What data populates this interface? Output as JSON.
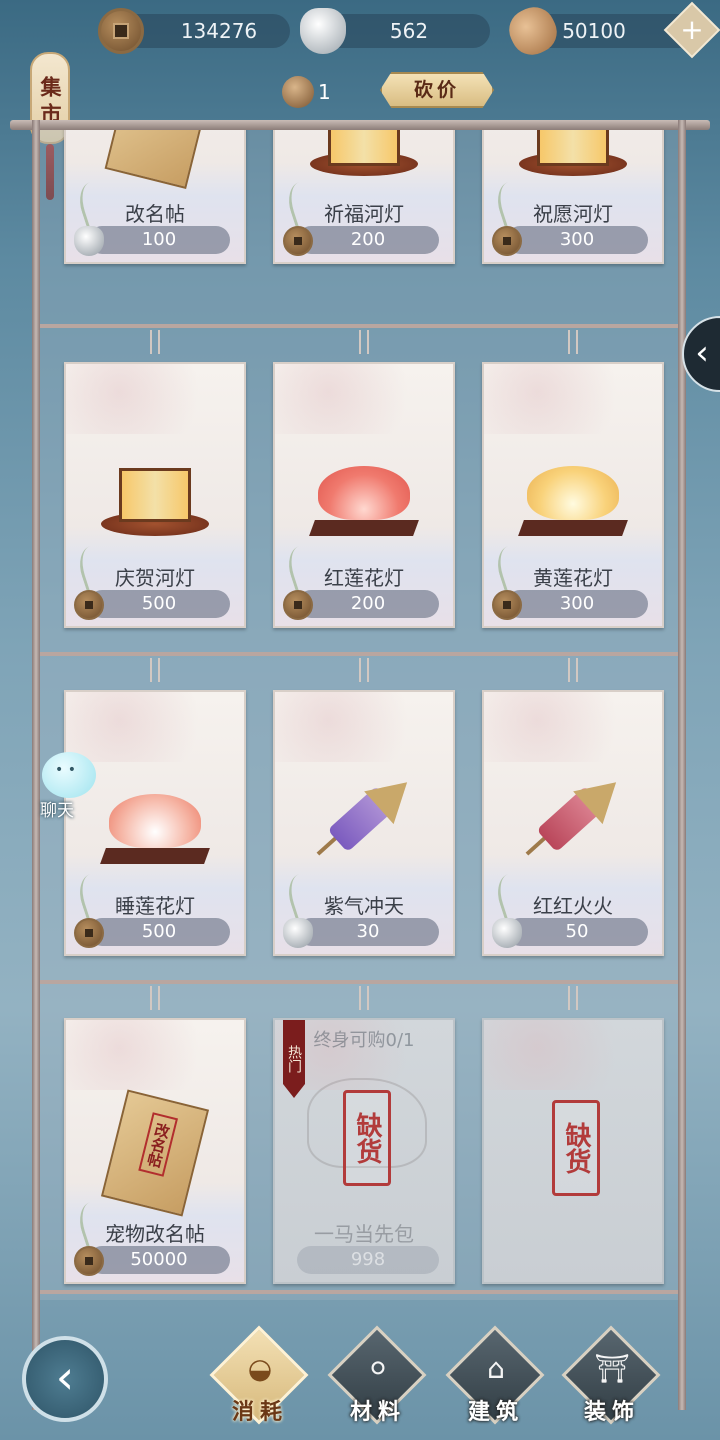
{
  "currency": {
    "coins": "134276",
    "silver": "562",
    "shells": "50100",
    "add_label": "+"
  },
  "market_sign": "集市",
  "bargain": {
    "token_count": "1",
    "button_label": "砍价"
  },
  "rows": [
    [
      {
        "name": "改名帖",
        "price": "100",
        "currency_icon": "silver-icon"
      },
      {
        "name": "祈福河灯",
        "price": "200",
        "currency_icon": "coin-icon"
      },
      {
        "name": "祝愿河灯",
        "price": "300",
        "currency_icon": "coin-icon"
      }
    ],
    [
      {
        "name": "庆贺河灯",
        "price": "500",
        "currency_icon": "coin-icon"
      },
      {
        "name": "红莲花灯",
        "price": "200",
        "currency_icon": "coin-icon"
      },
      {
        "name": "黄莲花灯",
        "price": "300",
        "currency_icon": "coin-icon"
      }
    ],
    [
      {
        "name": "睡莲花灯",
        "price": "500",
        "currency_icon": "coin-icon"
      },
      {
        "name": "紫气冲天",
        "price": "30",
        "currency_icon": "silver-icon"
      },
      {
        "name": "红红火火",
        "price": "50",
        "currency_icon": "silver-icon"
      }
    ],
    [
      {
        "name": "宠物改名帖",
        "price": "50000",
        "currency_icon": "coin-icon",
        "art_text": "改名帖"
      },
      {
        "name": "一马当先包",
        "price": "998",
        "currency_icon": "silver-icon",
        "sold_out": "缺货",
        "limit": "终身可购0/1",
        "hot_tag": "热门"
      },
      {
        "name": "",
        "price": "",
        "sold_out": "缺货"
      }
    ]
  ],
  "side_tab": "‹",
  "chat_label": "聊天",
  "back_button": "‹",
  "nav": [
    {
      "label": "消耗",
      "icon": "bowl-icon",
      "active": true
    },
    {
      "label": "材料",
      "icon": "materials-icon",
      "active": false
    },
    {
      "label": "建筑",
      "icon": "building-icon",
      "active": false
    },
    {
      "label": "装饰",
      "icon": "decoration-icon",
      "active": false
    }
  ]
}
